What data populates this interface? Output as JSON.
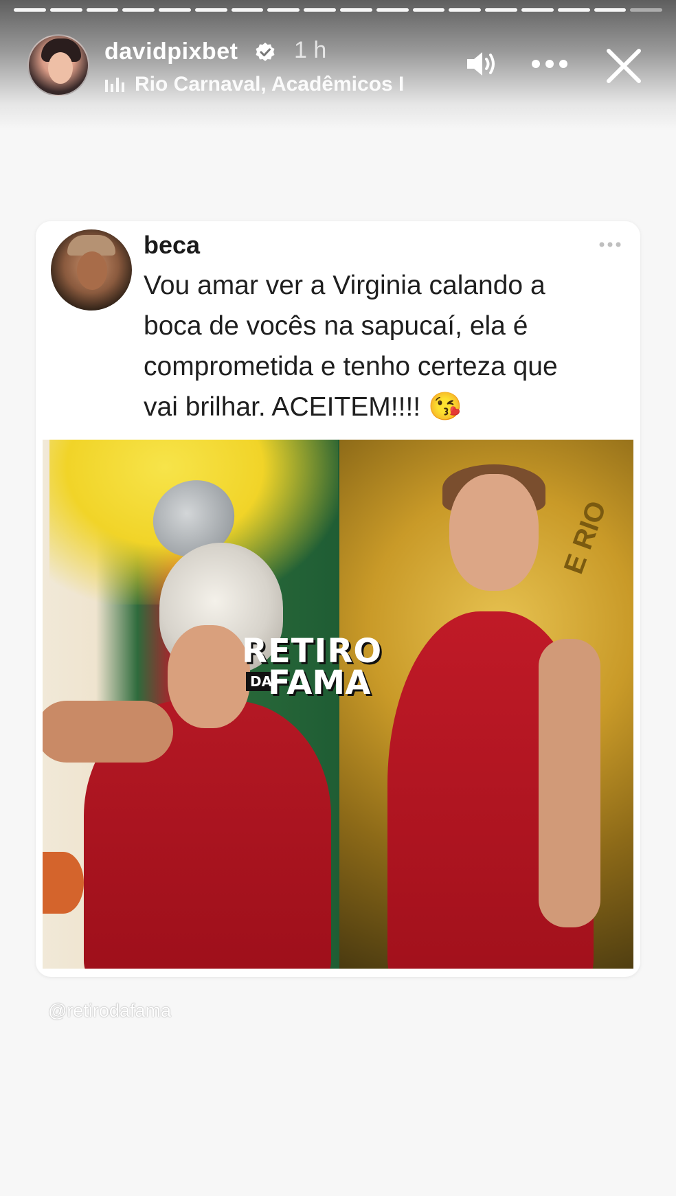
{
  "story": {
    "username": "davidpixbet",
    "time": "1 h",
    "location": "Rio Carnaval, Acadêmicos I",
    "progress_segments": 18,
    "progress_active": 17
  },
  "tweet": {
    "author": "beca",
    "lines": [
      "Vou amar ver a Virginia calando a",
      "boca de vocês na sapucaí, ela é",
      "comprometida e tenho certeza que",
      "vai brilhar. ACEITEM!!!!"
    ],
    "emoji": "😘"
  },
  "image": {
    "coin_text": "E RIO",
    "logo_line1": "RETIRO",
    "logo_line2": "DA",
    "logo_line3": "FAMA"
  },
  "watermark": "@retirodafama",
  "icons": {
    "verified": "verified-badge-icon",
    "music": "music-bars-icon",
    "sound": "speaker-icon",
    "more": "more-icon",
    "close": "close-icon",
    "tweet_more": "tweet-more-icon"
  },
  "colors": {
    "story_header_text": "#ffffff",
    "tweet_dress": "#b41824",
    "background": "#f7f7f7"
  }
}
